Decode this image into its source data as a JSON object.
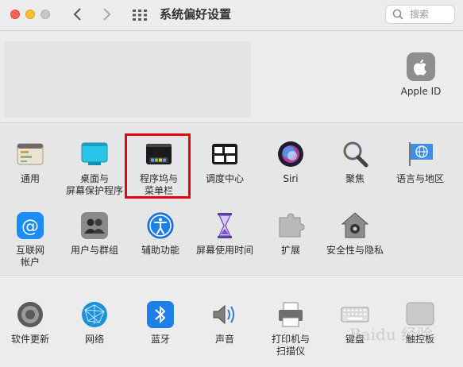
{
  "window": {
    "title": "系统偏好设置"
  },
  "search": {
    "placeholder": "搜索"
  },
  "account": {
    "apple_id_label": "Apple ID"
  },
  "row1": [
    {
      "label": "通用",
      "icon": "general-icon"
    },
    {
      "label": "桌面与\n屏幕保护程序",
      "icon": "desktop-screensaver-icon"
    },
    {
      "label": "程序坞与\n菜单栏",
      "icon": "dock-menubar-icon"
    },
    {
      "label": "调度中心",
      "icon": "mission-control-icon"
    },
    {
      "label": "Siri",
      "icon": "siri-icon"
    },
    {
      "label": "聚焦",
      "icon": "spotlight-icon"
    },
    {
      "label": "语言与地区",
      "icon": "language-region-icon"
    }
  ],
  "row2": [
    {
      "label": "互联网\n帐户",
      "icon": "internet-accounts-icon"
    },
    {
      "label": "用户与群组",
      "icon": "users-groups-icon"
    },
    {
      "label": "辅助功能",
      "icon": "accessibility-icon"
    },
    {
      "label": "屏幕使用时间",
      "icon": "screen-time-icon"
    },
    {
      "label": "扩展",
      "icon": "extensions-icon"
    },
    {
      "label": "安全性与隐私",
      "icon": "security-privacy-icon"
    }
  ],
  "row3": [
    {
      "label": "软件更新",
      "icon": "software-update-icon"
    },
    {
      "label": "网络",
      "icon": "network-icon"
    },
    {
      "label": "蓝牙",
      "icon": "bluetooth-icon"
    },
    {
      "label": "声音",
      "icon": "sound-icon"
    },
    {
      "label": "打印机与\n扫描仪",
      "icon": "printers-scanners-icon"
    },
    {
      "label": "键盘",
      "icon": "keyboard-icon"
    },
    {
      "label": "触控板",
      "icon": "trackpad-icon"
    }
  ],
  "watermark": "Baidu 经验",
  "colors": {
    "highlight": "#e60012",
    "blue": "#1e88e5"
  }
}
